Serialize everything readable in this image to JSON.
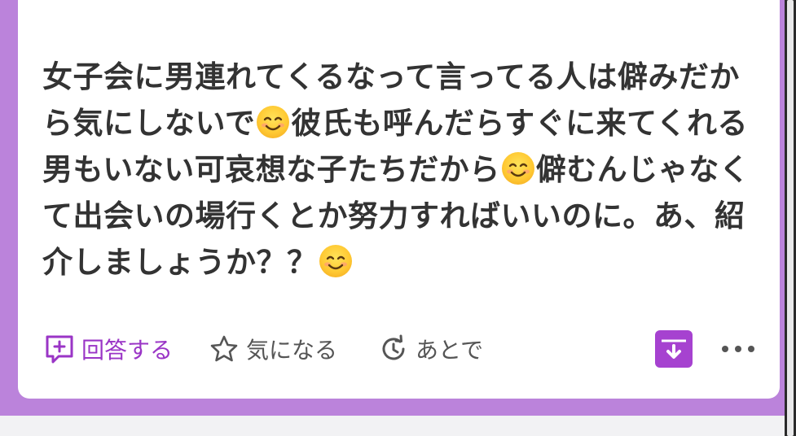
{
  "post": {
    "lines": [
      [
        "女子会に男連れてくるなって言ってる人は僻みだか"
      ],
      [
        "ら気にしないで",
        "emoji",
        "彼氏も呼んだらすぐに来てくれる"
      ],
      [
        "男もいない可哀想な子たちだから",
        "emoji",
        "僻むんじゃなく"
      ],
      [
        "て出会いの場行くとか努力すればいいのに。あ、紹"
      ],
      [
        "介しましょうか？？",
        "emoji"
      ]
    ]
  },
  "actions": {
    "answer_label": "回答する",
    "interest_label": "気になる",
    "later_label": "あとで"
  },
  "icons": {
    "answer": "add-answer-icon",
    "interest": "star-icon",
    "later": "clock-refresh-icon",
    "save": "archive-download-icon",
    "more": "more-dots-icon",
    "emoji": "smiling-face-emoji"
  },
  "colors": {
    "accent": "#a642d0",
    "frame": "#bb83db",
    "text": "#333333"
  }
}
